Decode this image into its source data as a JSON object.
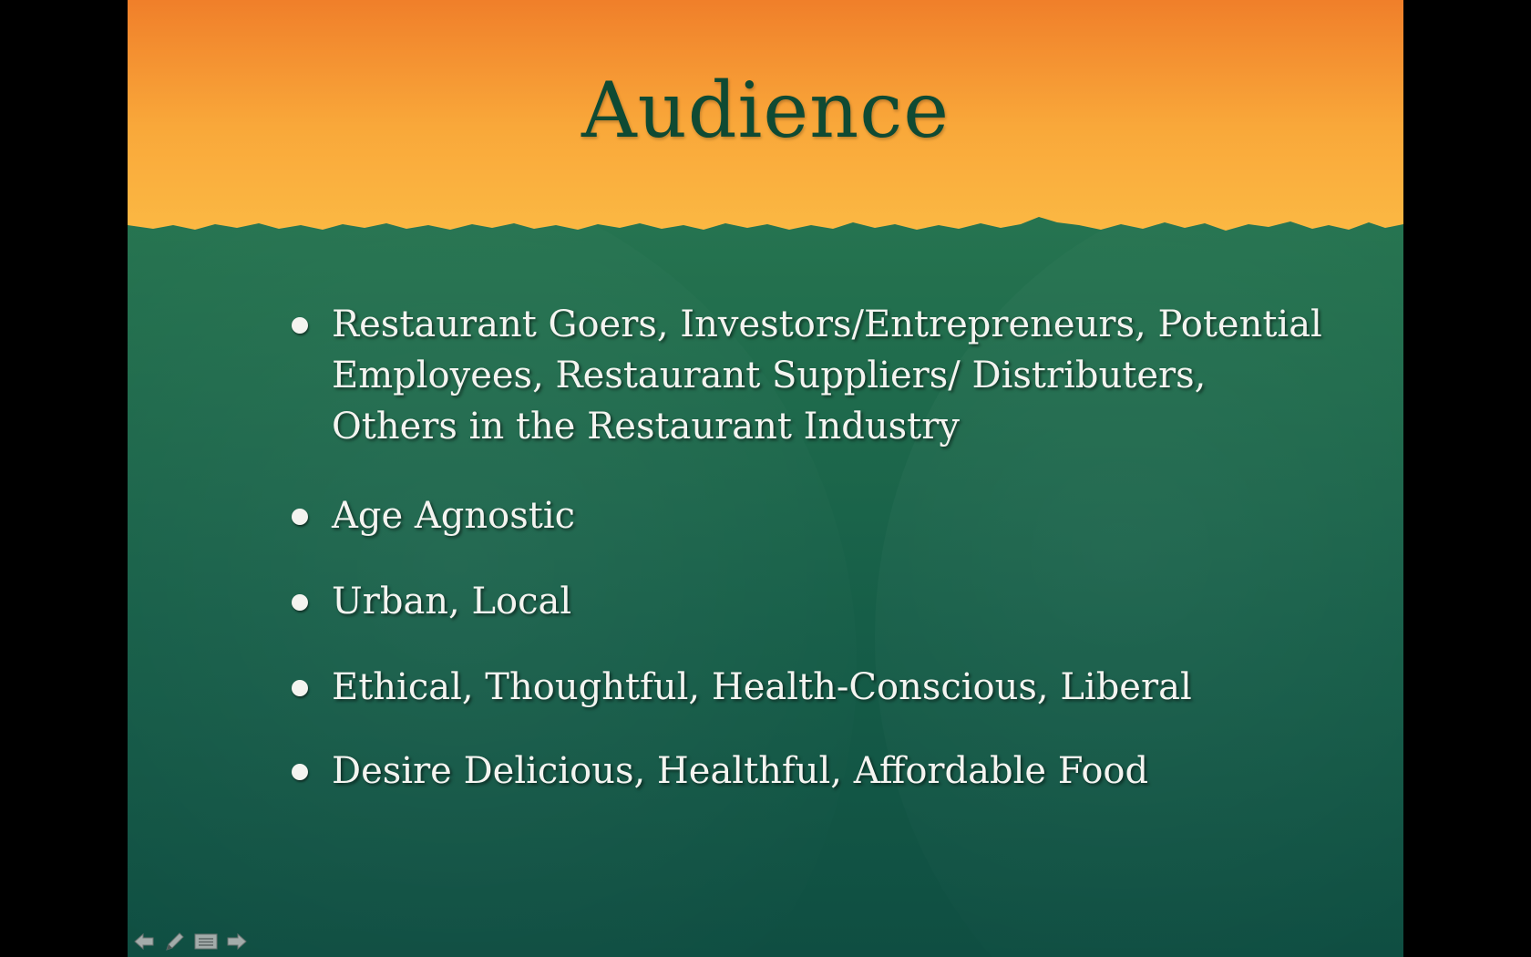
{
  "slide": {
    "title": "Audience",
    "bullets": [
      "Restaurant Goers, Investors/Entrepreneurs, Potential Employees, Restaurant Suppliers/ Distributers, Others in the Restaurant Industry",
      "Age Agnostic",
      "Urban, Local",
      "Ethical, Thoughtful, Health-Conscious, Liberal",
      "Desire Delicious, Healthful, Affordable Food"
    ]
  },
  "controls": {
    "icons": [
      "arrow-left-icon",
      "pen-icon",
      "menu-icon",
      "arrow-right-icon"
    ]
  },
  "colors": {
    "header_top": "#f28a2e",
    "header_bottom": "#fbb63c",
    "body_green": "#1f6b4c",
    "title_color": "#0f4a33",
    "text_color": "#f4f4f0"
  }
}
